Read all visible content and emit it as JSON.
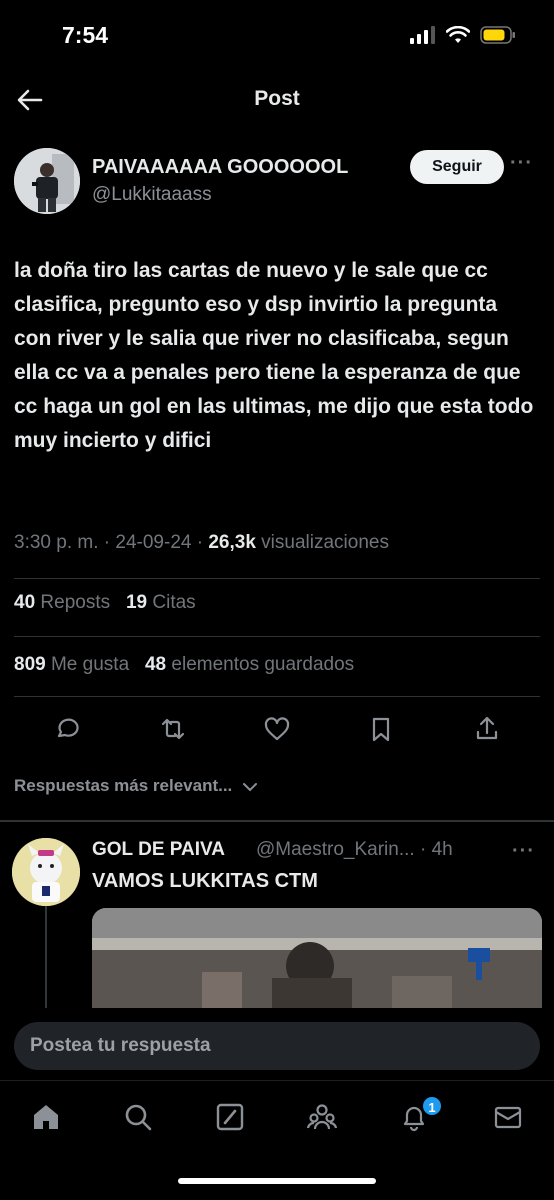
{
  "status_bar": {
    "time": "7:54"
  },
  "header": {
    "title": "Post"
  },
  "post": {
    "author_name": "PAIVAAAAAA GOOOOOOL",
    "author_handle": "@Lukkitaaass",
    "follow_label": "Seguir",
    "text": "la doña tiro las cartas de nuevo y le sale que cc clasifica, pregunto eso y dsp invirtio la pregunta con river y le salia que river no clasificaba, segun ella cc va a penales pero tiene la esperanza de que cc haga un gol en las ultimas, me dijo que esta todo muy incierto y difici",
    "time": "3:30 p. m.",
    "date": "24-09-24",
    "views_count": "26,3k",
    "views_label": "visualizaciones",
    "reposts_count": "40",
    "reposts_label": "Reposts",
    "quotes_count": "19",
    "quotes_label": "Citas",
    "likes_count": "809",
    "likes_label": "Me gusta",
    "bookmarks_count": "48",
    "bookmarks_label": "elementos guardados"
  },
  "replies_filter": {
    "label": "Respuestas más relevant..."
  },
  "reply": {
    "author_name": "GOL DE PAIVA",
    "author_handle": "@Maestro_Karin...",
    "time": "4h",
    "text": "VAMOS LUKKITAS CTM"
  },
  "composer": {
    "placeholder": "Postea tu respuesta"
  },
  "tab_bar": {
    "notifications_badge": "1"
  },
  "colors": {
    "accent": "#1d9bf0",
    "background": "#000000",
    "text": "#e7e9ea",
    "muted": "#71767b"
  }
}
